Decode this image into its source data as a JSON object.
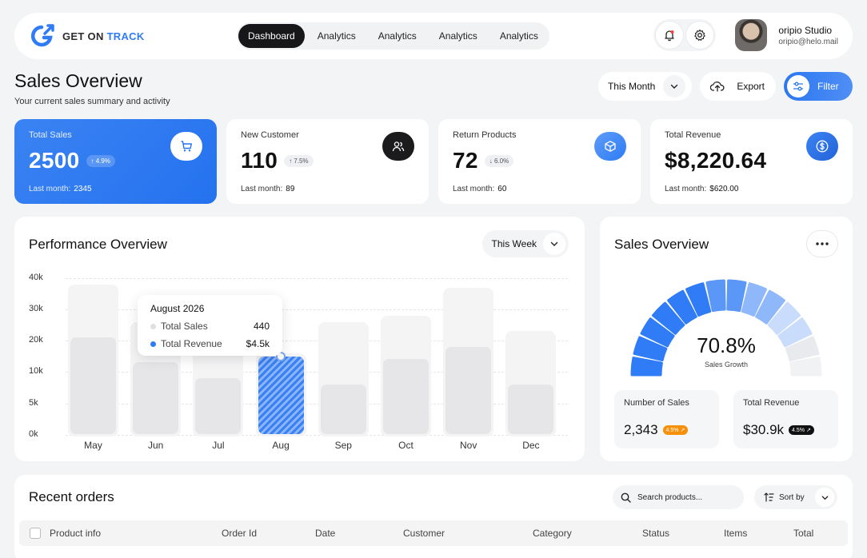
{
  "nav": {
    "brand": {
      "text_main": "GET ON ",
      "text_accent": "TRACK"
    },
    "tabs": [
      "Dashboard",
      "Analytics",
      "Analytics",
      "Analytics",
      "Analytics"
    ],
    "active_tab": 0,
    "user": {
      "name": "oripio Studio",
      "email": "oripio@helo.mail"
    },
    "icons": [
      "bell-icon",
      "gear-icon"
    ]
  },
  "header": {
    "title": "Sales Overview",
    "subtitle": "Your current sales summary and activity",
    "period_select": "This Month",
    "export_label": "Export",
    "filter_label": "Filter"
  },
  "stats": [
    {
      "label": "Total Sales",
      "value": "2500",
      "change": "4.9%",
      "direction": "up",
      "sub_label": "Last month:",
      "sub_value": "2345",
      "icon": "cart-icon"
    },
    {
      "label": "New Customer",
      "value": "110",
      "change": "7.5%",
      "direction": "up",
      "sub_label": "Last month:",
      "sub_value": "89",
      "icon": "users-icon"
    },
    {
      "label": "Return Products",
      "value": "72",
      "change": "6.0%",
      "direction": "down",
      "sub_label": "Last month:",
      "sub_value": "60",
      "icon": "box-icon"
    },
    {
      "label": "Total Revenue",
      "value": "$8,220.64",
      "change": "",
      "direction": "",
      "sub_label": "Last month:",
      "sub_value": "$620.00",
      "icon": "dollar-icon"
    }
  ],
  "performance": {
    "title": "Performance Overview",
    "range_select": "This Week",
    "tooltip": {
      "title": "August 2026",
      "rows": [
        {
          "name": "Total Sales",
          "value": "440"
        },
        {
          "name": "Total Revenue",
          "value": "$4.5k"
        }
      ]
    }
  },
  "chart_data": {
    "type": "bar",
    "categories": [
      "May",
      "Jun",
      "Jul",
      "Aug",
      "Sep",
      "Oct",
      "Nov",
      "Dec"
    ],
    "y_ticks": [
      "40k",
      "30k",
      "20k",
      "10k",
      "5k",
      "0k"
    ],
    "series": [
      {
        "name": "",
        "values": [
          38000,
          26000,
          31000,
          16000,
          26000,
          28000,
          37000,
          23000
        ]
      },
      {
        "name": "",
        "values": [
          21000,
          13000,
          9000,
          15000,
          8000,
          14000,
          18000,
          8000
        ]
      }
    ],
    "highlight_index": 3,
    "colors": {
      "background": "#f4f4f5",
      "bar": "#e6e6e8",
      "highlight": "#3a82f4"
    }
  },
  "sales_overview": {
    "title": "Sales Overview",
    "gauge_value": "70.8%",
    "gauge_fraction": 0.708,
    "gauge_label": "Sales Growth",
    "metrics": [
      {
        "label": "Number of Sales",
        "value": "2,343",
        "badge": "4.5% ↗",
        "badge_style": "orange"
      },
      {
        "label": "Total Revenue",
        "value": "$30.9k",
        "badge": "4.5% ↗",
        "badge_style": "dark"
      }
    ]
  },
  "orders": {
    "title": "Recent orders",
    "search_placeholder": "Search products...",
    "sort_label": "Sort by",
    "columns": [
      "Product info",
      "Order Id",
      "Date",
      "Customer",
      "Category",
      "Status",
      "Items",
      "Total"
    ]
  }
}
